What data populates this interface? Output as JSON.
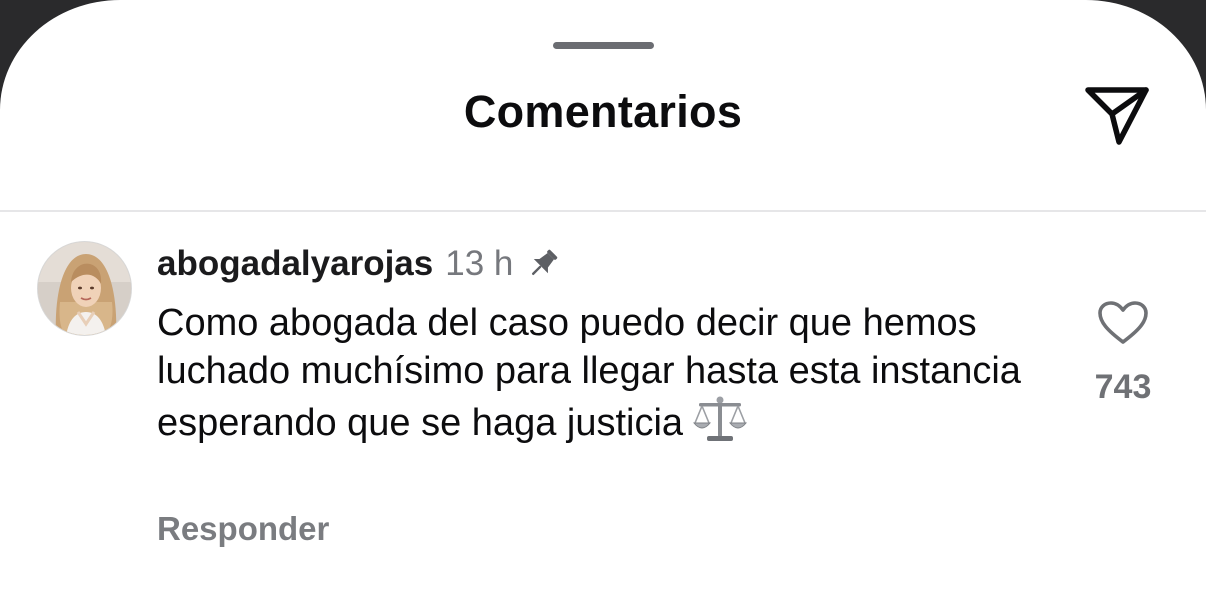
{
  "sheet": {
    "title": "Comentarios",
    "icons": {
      "send": "paper-plane-icon",
      "grabber": "drag-handle"
    }
  },
  "comment": {
    "username": "abogadalyarojas",
    "time": "13 h",
    "pinned_icon": "pin-icon",
    "text": "Como abogada del caso puedo decir que hemos luchado muchísimo para llegar hasta esta instancia esperando que se haga justicia",
    "emoji": "balance-scale-emoji",
    "reply_label": "Responder",
    "like_icon": "heart-outline-icon",
    "like_count": "743"
  },
  "colors": {
    "background": "#ffffff",
    "primary_text": "#0c0c0e",
    "secondary_text": "#76787d",
    "divider": "#e6e6e8"
  }
}
